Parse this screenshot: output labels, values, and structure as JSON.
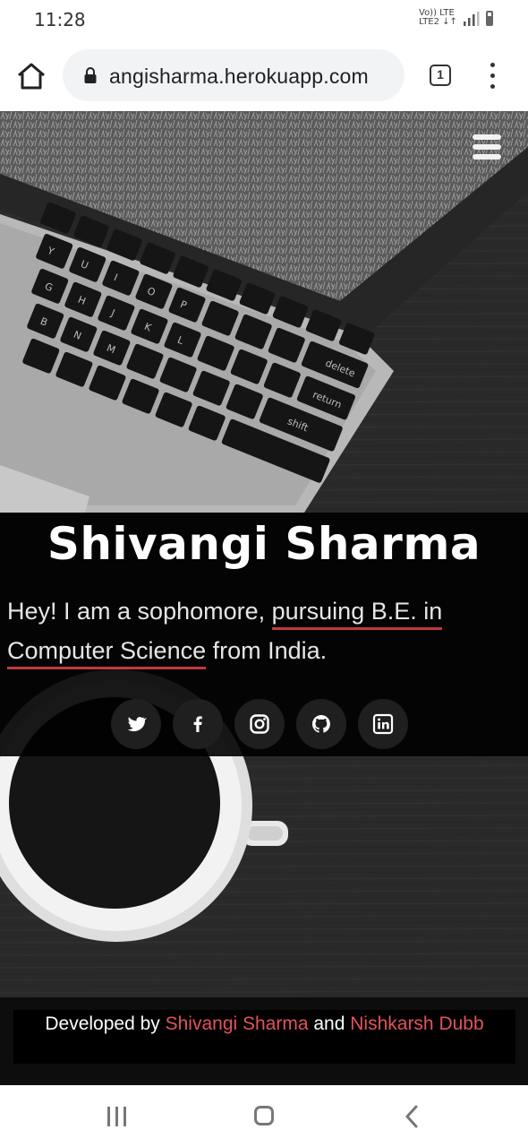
{
  "status_bar": {
    "time": "11:28",
    "network_top": "Vo)) LTE",
    "network_bottom": "LTE2 ↓↑"
  },
  "browser": {
    "url": "angisharma.herokuapp.com",
    "tab_count": "1"
  },
  "hero": {
    "name": "Shivangi Sharma",
    "tagline_before": "Hey! I am a sophomore, ",
    "tagline_highlight": "pursuing B.E. in Computer Science",
    "tagline_after": " from India.",
    "social_icons": [
      "twitter-icon",
      "facebook-icon",
      "instagram-icon",
      "github-icon",
      "linkedin-icon"
    ]
  },
  "footer": {
    "prefix": "Developed by ",
    "author1": "Shivangi Sharma",
    "joiner": " and ",
    "author2": "Nishkarsh Dubb"
  },
  "colors": {
    "accent": "#e0535b",
    "underline": "#c0393e"
  }
}
